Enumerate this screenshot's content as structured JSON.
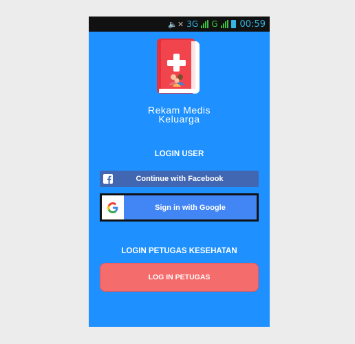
{
  "statusbar": {
    "network": "3G",
    "network2": "G",
    "time": "00:59"
  },
  "app": {
    "title_line1": "Rekam Medis",
    "title_line2": "Keluarga"
  },
  "login_user": {
    "heading": "LOGIN USER",
    "facebook_label": "Continue with Facebook",
    "google_label": "Sign in with Google"
  },
  "login_petugas": {
    "heading": "LOGIN PETUGAS KESEHATAN",
    "button_label": "LOG IN PETUGAS"
  },
  "colors": {
    "background": "#1e90ff",
    "facebook": "#4267b2",
    "google": "#4285f4",
    "petugas_button": "#f56c6c"
  },
  "icons": [
    "volume-mute-icon",
    "signal-icon",
    "battery-icon",
    "app-logo-icon",
    "facebook-icon",
    "google-icon"
  ]
}
